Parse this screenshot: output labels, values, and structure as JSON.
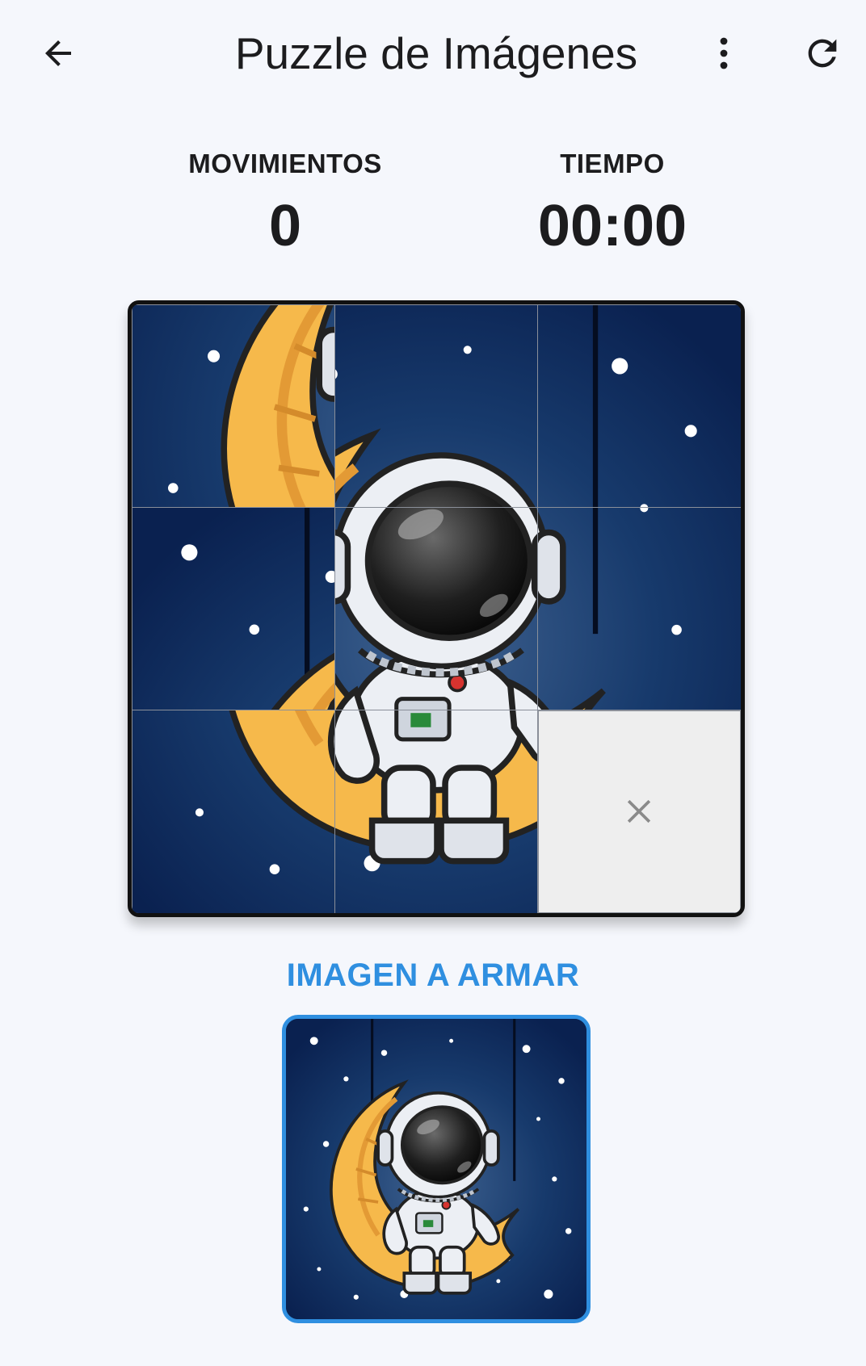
{
  "app": {
    "title": "Puzzle de Imágenes"
  },
  "header": {
    "back_icon": "arrow-left-icon",
    "menu_icon": "more-vertical-icon",
    "refresh_icon": "refresh-icon"
  },
  "stats": {
    "moves_label": "MOVIMIENTOS",
    "moves_value": "0",
    "time_label": "TIEMPO",
    "time_value": "00:00"
  },
  "puzzle": {
    "grid_size": 3,
    "tiles": [
      {
        "piece": 3
      },
      {
        "piece": 1
      },
      {
        "piece": 2
      },
      {
        "piece": 0
      },
      {
        "piece": 4
      },
      {
        "piece": 5
      },
      {
        "piece": 6
      },
      {
        "piece": 7
      },
      {
        "piece": null
      }
    ],
    "empty_icon": "close-icon"
  },
  "reference": {
    "label": "IMAGEN A ARMAR"
  },
  "colors": {
    "accent": "#2f8fe0",
    "space": "#0c2450",
    "moon": "#f6b94b",
    "empty_tile": "#eeeeee",
    "background": "#f5f7fc"
  }
}
